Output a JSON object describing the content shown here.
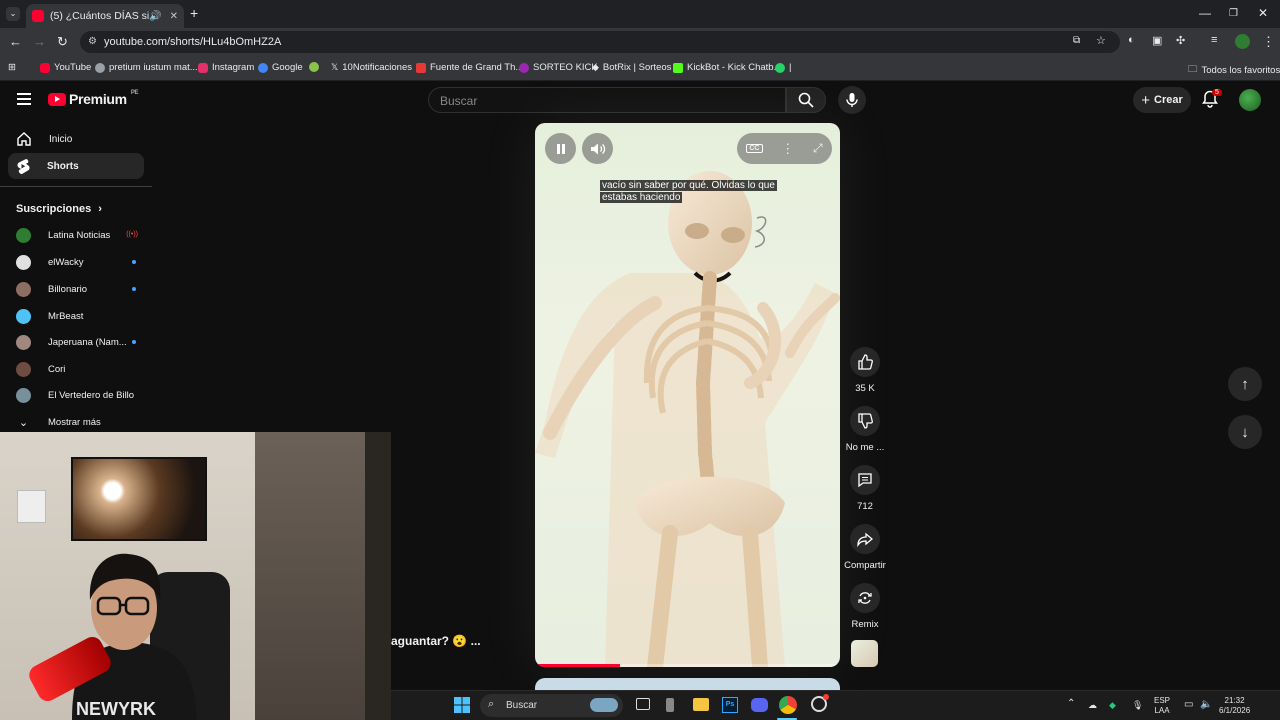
{
  "browser": {
    "tab_title": "(5) ¿Cuántos DÍAS sin dormir",
    "url": "youtube.com/shorts/HLu4bOmHZ2A",
    "bookmarks": [
      {
        "label": "YouTube",
        "color": "#ff0033"
      },
      {
        "label": "pretium iustum mat...",
        "color": "#9aa0a6"
      },
      {
        "label": "Instagram",
        "color": "#e1306c"
      },
      {
        "label": "Google",
        "color": "#4285f4"
      },
      {
        "label": "",
        "color": "#8bc34a"
      },
      {
        "label": "10Notificaciones",
        "color": "#ffffff"
      },
      {
        "label": "Fuente de Grand Th...",
        "color": "#e53935"
      },
      {
        "label": "SORTEO KICK",
        "color": "#9c27b0"
      },
      {
        "label": "BotRix | Sorteos",
        "color": "#ffffff"
      },
      {
        "label": "KickBot - Kick Chatb...",
        "color": "#53fc18"
      },
      {
        "label": "|",
        "color": "#25d366"
      }
    ],
    "all_bookmarks": "Todos los favoritos"
  },
  "header": {
    "logo": "Premium",
    "logo_region": "PE",
    "search_placeholder": "Buscar",
    "create_label": "Crear",
    "notification_count": "5"
  },
  "sidebar": {
    "items": [
      {
        "label": "Inicio"
      },
      {
        "label": "Shorts"
      }
    ],
    "subscriptions_title": "Suscripciones",
    "subscriptions": [
      {
        "label": "Latina Noticias",
        "color": "#2e7d32",
        "live": true
      },
      {
        "label": "elWacky",
        "color": "#e0e0e0",
        "new": true
      },
      {
        "label": "Billonario",
        "color": "#8d6e63",
        "new": true
      },
      {
        "label": "MrBeast",
        "color": "#4fc3f7",
        "new": false
      },
      {
        "label": "Japeruana (Nam...",
        "color": "#a1887f",
        "new": true
      },
      {
        "label": "Cori",
        "color": "#6d4c41",
        "new": false
      },
      {
        "label": "El Vertedero de Billo",
        "color": "#78909c",
        "new": false
      }
    ],
    "show_more": "Mostrar más"
  },
  "short": {
    "subtitle_line1": "vacío sin saber por qué. Olvidas lo que",
    "subtitle_line2": "estabas haciendo",
    "progress": 0.28,
    "overlap_caption": "aguantar? 😮 ..."
  },
  "actions": {
    "likes": "35 K",
    "dislike": "No me ...",
    "comments": "712",
    "share": "Compartir",
    "remix": "Remix"
  },
  "taskbar": {
    "search": "Buscar",
    "lang_top": "ESP",
    "lang_bottom": "LAA",
    "time": "21:32",
    "date": "6/1/2026"
  }
}
